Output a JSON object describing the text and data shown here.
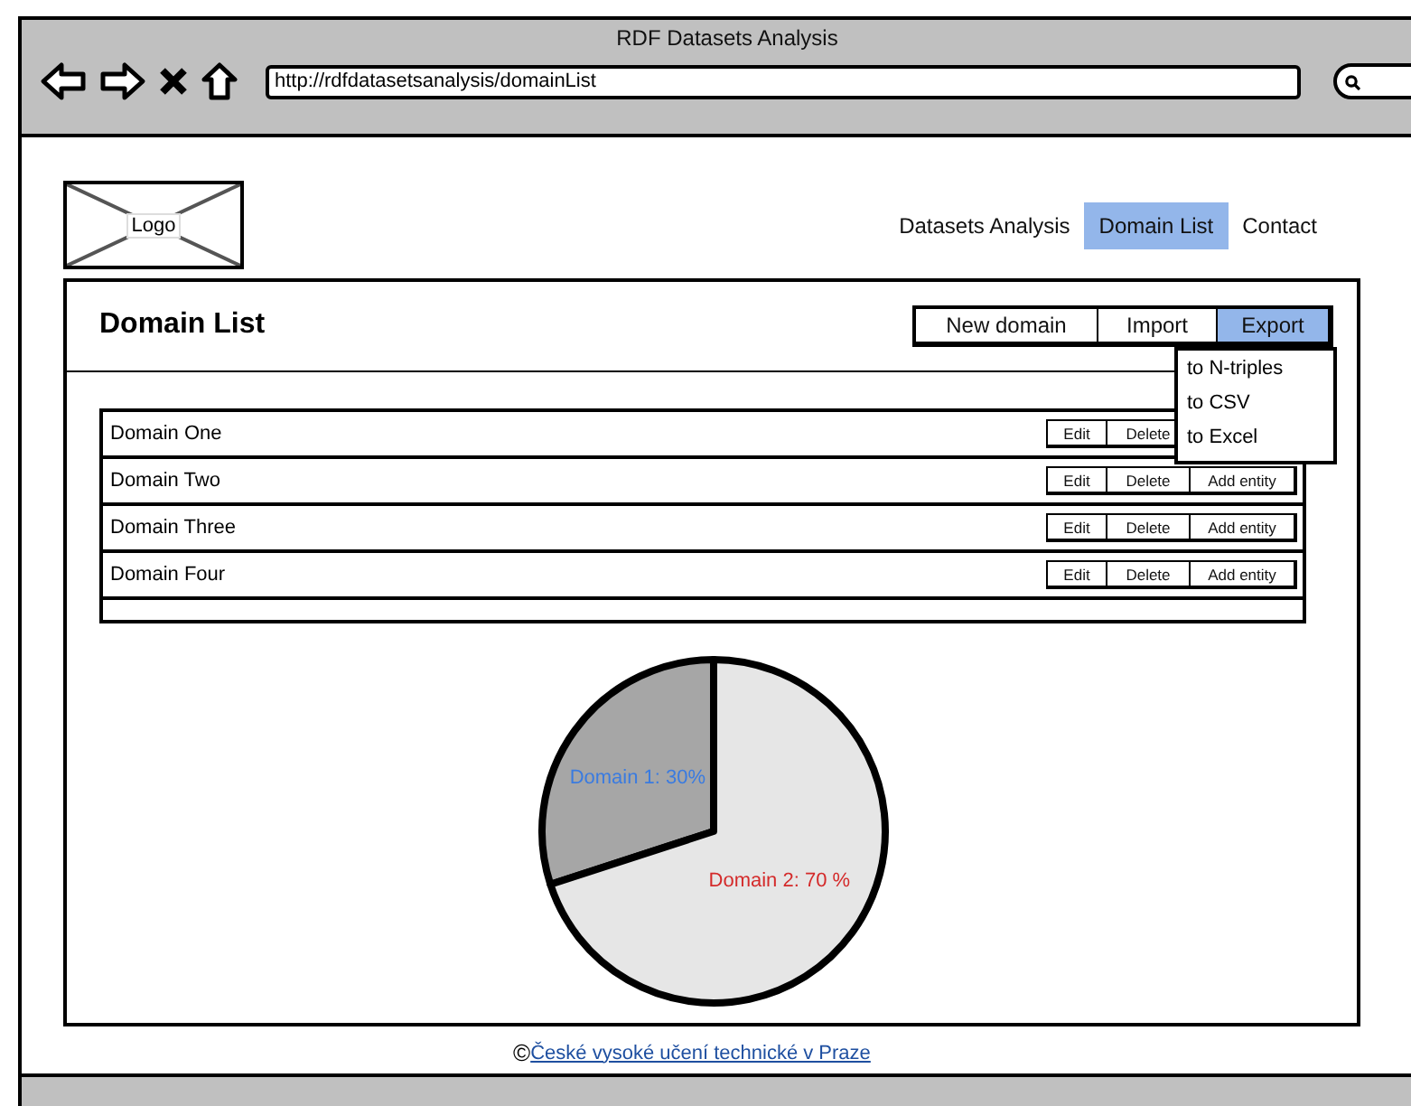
{
  "window": {
    "title": "RDF Datasets Analysis",
    "url": "http://rdfdatasetsanalysis/domainList"
  },
  "header": {
    "logo": "Logo",
    "nav": [
      {
        "label": "Datasets Analysis",
        "selected": false
      },
      {
        "label": "Domain List",
        "selected": true
      },
      {
        "label": "Contact",
        "selected": false
      }
    ]
  },
  "panel": {
    "title": "Domain List",
    "buttons": [
      {
        "label": "New domain",
        "selected": false
      },
      {
        "label": "Import",
        "selected": false
      },
      {
        "label": "Export",
        "selected": true
      }
    ],
    "export_menu": [
      "to N-triples",
      "to CSV",
      "to Excel"
    ],
    "rows": [
      {
        "name": "Domain One",
        "actions": [
          "Edit",
          "Delete"
        ]
      },
      {
        "name": "Domain Two",
        "actions": [
          "Edit",
          "Delete",
          "Add entity"
        ]
      },
      {
        "name": "Domain Three",
        "actions": [
          "Edit",
          "Delete",
          "Add entity"
        ]
      },
      {
        "name": "Domain Four",
        "actions": [
          "Edit",
          "Delete",
          "Add entity"
        ]
      }
    ],
    "chart_data": {
      "type": "pie",
      "values": [
        30,
        70
      ],
      "value_labels": [
        "Domain 1: 30%",
        "Domain 2: 70 %"
      ]
    }
  },
  "footer": {
    "symbol": "©",
    "link": "České vysoké učení technické v Praze"
  }
}
